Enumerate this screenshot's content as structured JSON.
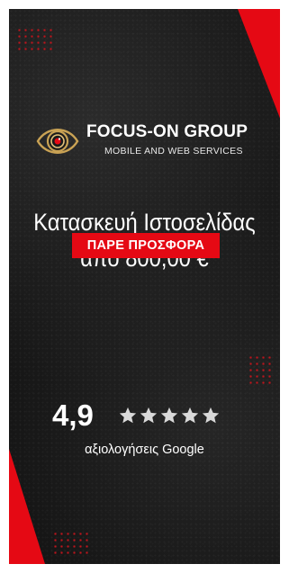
{
  "brand": {
    "name": "FOCUS-ON GROUP",
    "tagline": "MOBILE AND WEB SERVICES",
    "logo_icon": "eye-lens-logo-icon"
  },
  "headline": {
    "line1": "Κατασκευή Ιστοσελίδας",
    "line2": "από 800,00 €"
  },
  "cta": {
    "label": "ΠΑΡΕ ΠΡΟΣΦΟΡΑ"
  },
  "rating": {
    "score": "4,9",
    "stars_total": 5,
    "label": "αξιολογήσεις Google"
  },
  "colors": {
    "accent_red": "#e50914",
    "gold": "#c9a254",
    "background": "#141414",
    "star_gray": "#d9d9d9"
  }
}
